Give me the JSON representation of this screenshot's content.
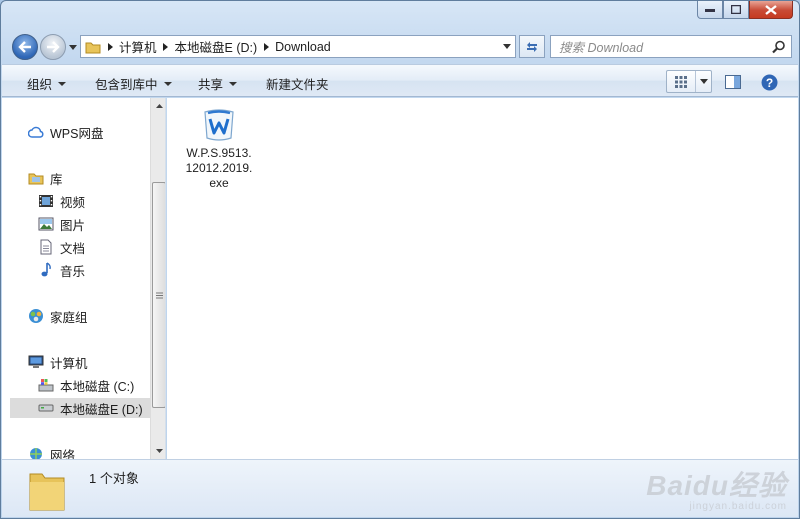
{
  "window": {
    "accent_color": "#2e66b6",
    "close_color": "#c63a20"
  },
  "address_bar": {
    "segments": [
      "计算机",
      "本地磁盘E (D:)",
      "Download"
    ]
  },
  "search": {
    "placeholder": "搜索 Download"
  },
  "toolbar": {
    "organize": "组织",
    "include_in_library": "包含到库中",
    "share": "共享",
    "new_folder": "新建文件夹",
    "view_icon": "grid-view-icon",
    "preview_icon": "preview-pane-icon",
    "help_icon": "help-icon"
  },
  "nav_pane": {
    "wps_cloud": "WPS网盘",
    "libraries": "库",
    "videos": "视频",
    "pictures": "图片",
    "documents": "文档",
    "music": "音乐",
    "homegroup": "家庭组",
    "computer": "计算机",
    "drive_c": "本地磁盘 (C:)",
    "drive_d": "本地磁盘E (D:)",
    "network": "网络"
  },
  "files": [
    {
      "name": "W.P.S.9513.12012.2019.exe",
      "icon": "wps-installer-icon"
    }
  ],
  "details_pane": {
    "item_count": "1 个对象"
  },
  "watermark": {
    "brand": "Baidu经验",
    "url": "jingyan.baidu.com"
  }
}
